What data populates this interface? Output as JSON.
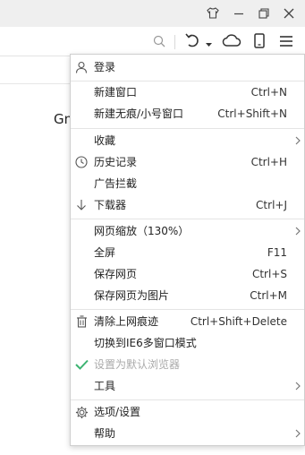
{
  "page": {
    "partial_text": "Gm"
  },
  "menu": {
    "login": {
      "label": "登录"
    },
    "new_window": {
      "label": "新建窗口",
      "shortcut": "Ctrl+N"
    },
    "new_incognito": {
      "label": "新建无痕/小号窗口",
      "shortcut": "Ctrl+Shift+N"
    },
    "favorites": {
      "label": "收藏"
    },
    "history": {
      "label": "历史记录",
      "shortcut": "Ctrl+H"
    },
    "adblock": {
      "label": "广告拦截"
    },
    "downloads": {
      "label": "下载器",
      "shortcut": "Ctrl+J"
    },
    "zoom": {
      "label": "网页缩放（130%）"
    },
    "fullscreen": {
      "label": "全屏",
      "shortcut": "F11"
    },
    "save_page": {
      "label": "保存网页",
      "shortcut": "Ctrl+S"
    },
    "save_as_image": {
      "label": "保存网页为图片",
      "shortcut": "Ctrl+M"
    },
    "clear_traces": {
      "label": "清除上网痕迹",
      "shortcut": "Ctrl+Shift+Delete"
    },
    "ie6_mode": {
      "label": "切换到IE6多窗口模式"
    },
    "set_default": {
      "label": "设置为默认浏览器"
    },
    "tools": {
      "label": "工具"
    },
    "options": {
      "label": "选项/设置"
    },
    "help": {
      "label": "帮助"
    }
  },
  "colors": {
    "check_green": "#3cb371",
    "icon_gray": "#555555",
    "title_bar": "#efefef"
  }
}
